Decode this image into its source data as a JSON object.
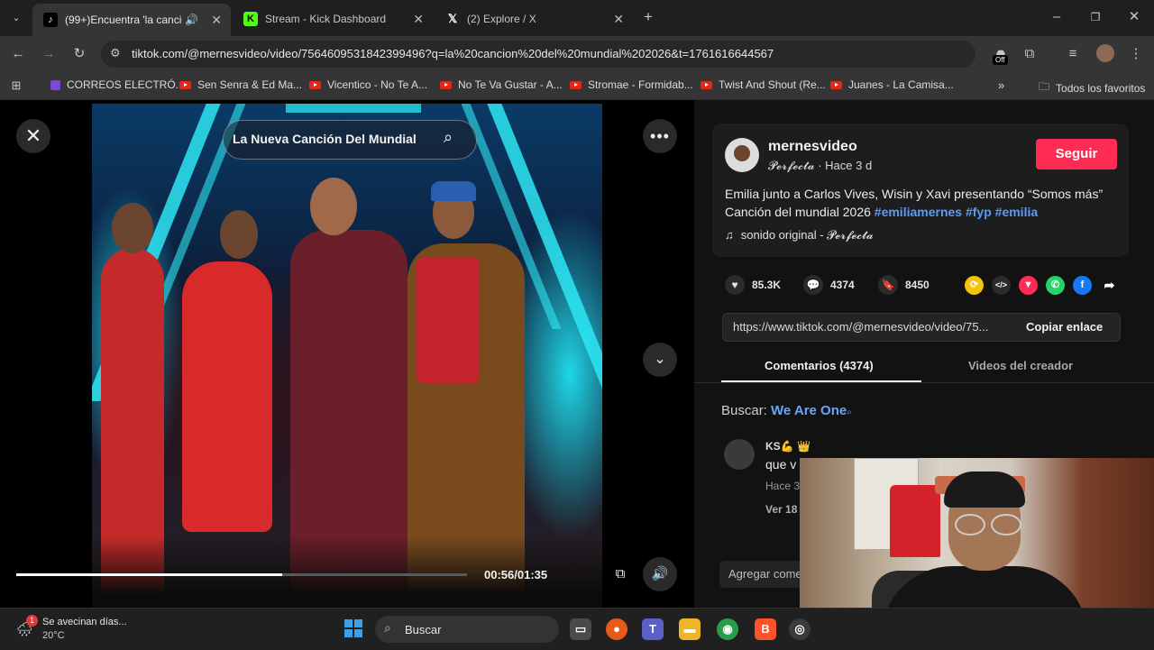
{
  "tabs": [
    {
      "title": "(99+)Encuentra 'la cancion",
      "icon": "tiktok-icon",
      "active": true
    },
    {
      "title": "Stream - Kick Dashboard",
      "icon": "kick-icon",
      "active": false
    },
    {
      "title": "(2) Explore / X",
      "icon": "x-icon",
      "active": false
    }
  ],
  "address_bar": {
    "url": "tiktok.com/@mernesvideo/video/7564609531842399496?q=la%20cancion%20del%20mundial%202026&t=1761616644567"
  },
  "bookmarks": [
    {
      "label": "CORREOS ELECTRÓ...",
      "icon": "mail-icon"
    },
    {
      "label": "Sen Senra & Ed Ma...",
      "icon": "youtube-icon"
    },
    {
      "label": "Vicentico - No Te A...",
      "icon": "youtube-icon"
    },
    {
      "label": "No Te Va Gustar - A...",
      "icon": "youtube-icon"
    },
    {
      "label": "Stromae - Formidab...",
      "icon": "youtube-icon"
    },
    {
      "label": "Twist And Shout (Re...",
      "icon": "youtube-icon"
    },
    {
      "label": "Juanes - La Camisa...",
      "icon": "youtube-icon"
    }
  ],
  "bookmarks_all": "Todos los favoritos",
  "extension_badge": "Off",
  "video": {
    "search_pill": "La Nueva Canción Del Mundial",
    "time": "00:56/01:35",
    "progress": 0.59
  },
  "post": {
    "username": "mernesvideo",
    "nickname": "𝓟𝓮𝓻𝓯𝓮𝓬𝓽𝓪",
    "age": "Hace 3 d",
    "separator": " · ",
    "follow_label": "Seguir",
    "description": "Emilia junto a Carlos Vives, Wisin y Xavi presentando “Somos más” Canción del mundial 2026 ",
    "hashtags": [
      "#emiliamernes",
      "#fyp",
      "#emilia"
    ],
    "sound": "sonido original - 𝓟𝓮𝓻𝓯𝓮𝓬𝓽𝓪",
    "likes": "85.3K",
    "comments": "4374",
    "saves": "8450",
    "link": "https://www.tiktok.com/@mernesvideo/video/75...",
    "copy_label": "Copiar enlace"
  },
  "panel_tabs": {
    "comments": "Comentarios (4374)",
    "creator": "Videos del creador"
  },
  "search_suggest": {
    "label": "Buscar:",
    "term": "We Are One"
  },
  "comment": {
    "name": "KS💪 👑",
    "text": "que v",
    "time": "Hace 3",
    "more": "Ver 18"
  },
  "add_comment": "Agregar come",
  "taskbar": {
    "weather_title": "Se avecinan días...",
    "weather_temp": "20°C",
    "weather_badge": "1",
    "search": "Buscar"
  },
  "colors": {
    "accent": "#fe2c55",
    "hashtag": "#5b9cf5",
    "background": "#121212"
  }
}
